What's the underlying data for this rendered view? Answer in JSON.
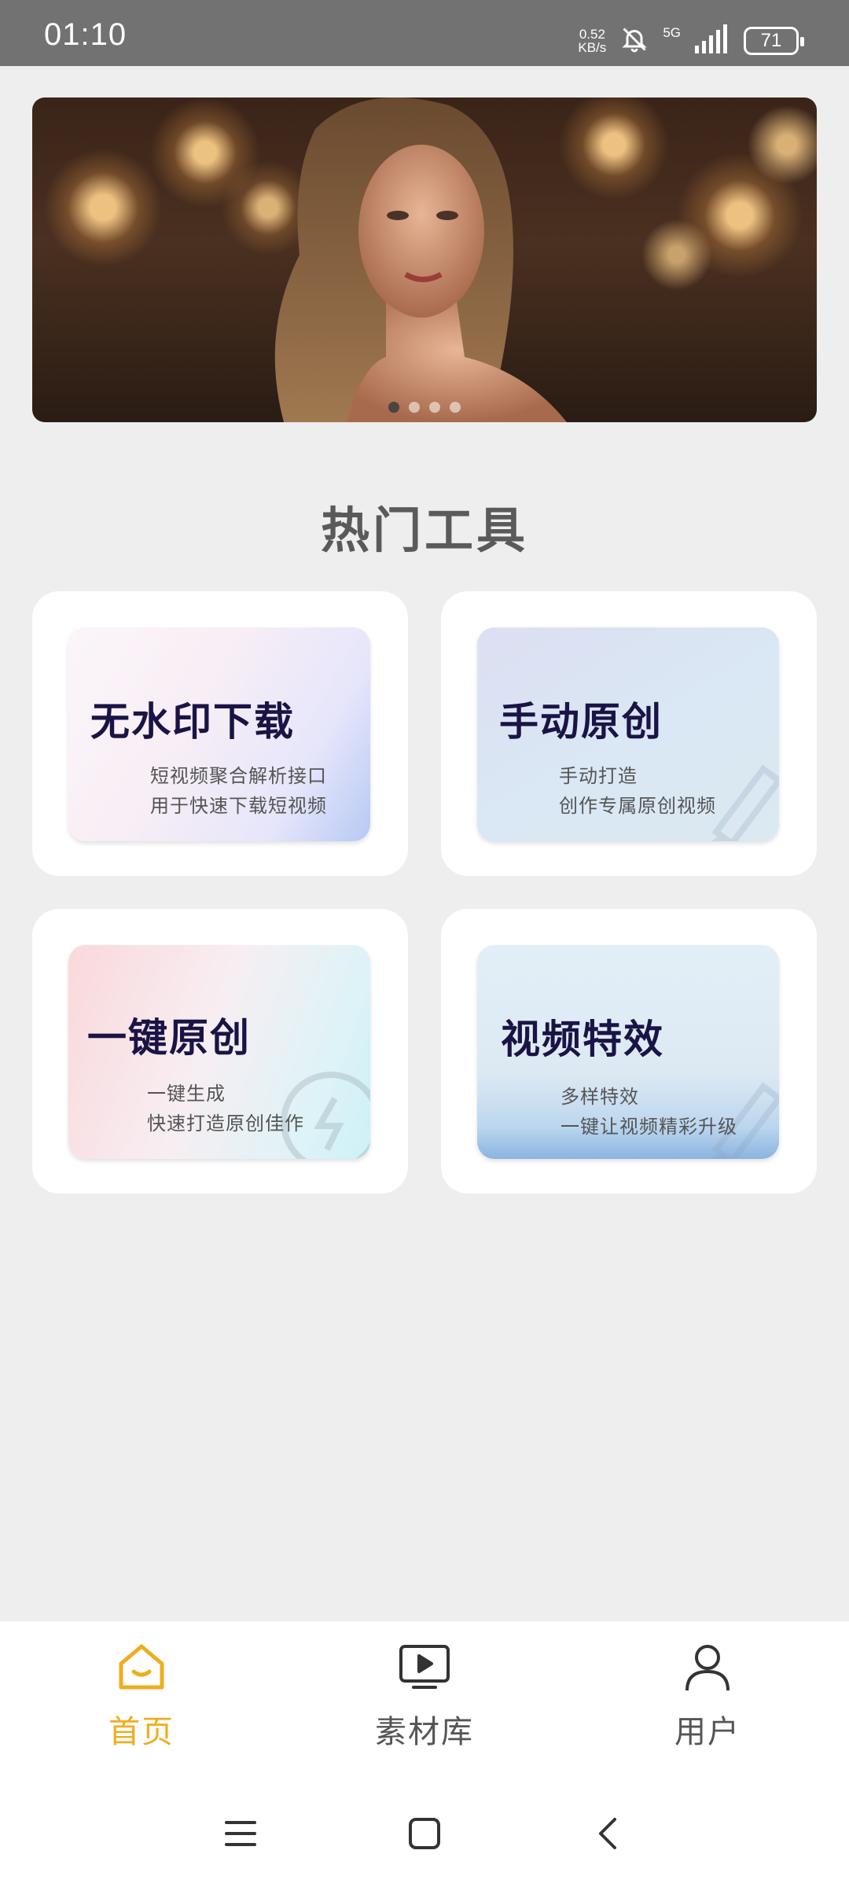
{
  "status_bar": {
    "time": "01:10",
    "net_speed_value": "0.52",
    "net_speed_unit": "KB/s",
    "network": "5G",
    "battery": "71"
  },
  "banner": {
    "dots_total": 4,
    "active_dot": 0
  },
  "section": {
    "title": "热门工具"
  },
  "tools": [
    {
      "title": "无水印下载",
      "desc1": "短视频聚合解析接口",
      "desc2": "用于快速下载短视频"
    },
    {
      "title": "手动原创",
      "desc1": "手动打造",
      "desc2": "创作专属原创视频"
    },
    {
      "title": "一键原创",
      "desc1": "一键生成",
      "desc2": "快速打造原创佳作"
    },
    {
      "title": "视频特效",
      "desc1": "多样特效",
      "desc2": "一键让视频精彩升级"
    }
  ],
  "nav": {
    "home": "首页",
    "library": "素材库",
    "user": "用户",
    "active": "home",
    "active_color": "#efad1f"
  }
}
